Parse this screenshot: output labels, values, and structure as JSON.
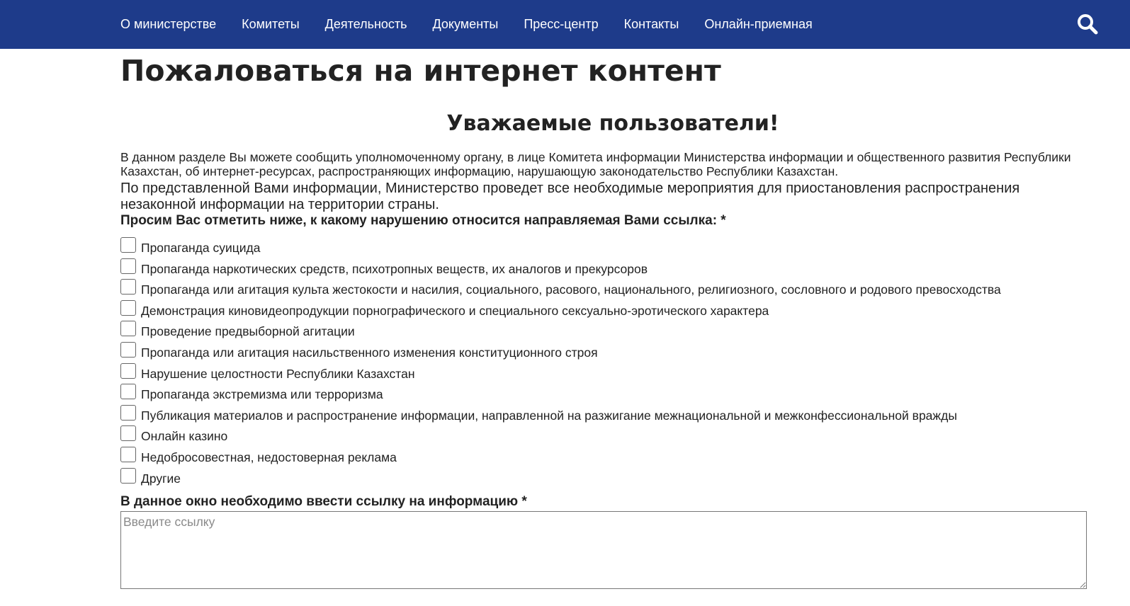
{
  "header": {
    "nav_items": [
      "О министерстве",
      "Комитеты",
      "Деятельность",
      "Документы",
      "Пресс-центр",
      "Контакты",
      "Онлайн-приемная"
    ],
    "search_icon": "search-icon",
    "background_color": "#1e3b8a"
  },
  "main": {
    "title": "Пожаловаться на интернет контент",
    "greeting": "Уважаемые пользователи!",
    "intro_text": "В данном разделе Вы можете сообщить уполномоченному органу, в лице Комитета информации Министерства информации и общественного развития Республики Казахстан, об интернет-ресурсах, распространяющих информацию, нарушающую законодательство Республики Казахстан.",
    "intro_text_2": "По представленной Вами информации, Министерство проведет все необходимые мероприятия для приостановления распространения незаконной информации на территории страны.",
    "violation_question": "Просим Вас отметить ниже, к какому нарушению относится направляемая Вами ссылка: *",
    "violation_options": [
      "Пропаганда суицида",
      "Пропаганда наркотических средств, психотропных веществ, их аналогов и прекурсоров",
      "Пропаганда или агитация культа жестокости и насилия, социального, расового, национального, религиозного, сословного и родового превосходства",
      "Демонстрация киновидеопродукции порнографического и специального сексуально-эротического характера",
      "Проведение предвыборной агитации",
      "Пропаганда или агитация насильственного изменения конституционного строя",
      "Нарушение целостности Республики Казахстан",
      "Пропаганда экстремизма или терроризма",
      "Публикация материалов и распространение информации, направленной на разжигание межнациональной и межконфессиональной вражды",
      "Онлайн казино",
      "Недобросовестная, недостоверная реклама",
      "Другие"
    ],
    "link_label": "В данное окно необходимо ввести ссылку на информацию *",
    "link_placeholder": "Введите ссылку",
    "link_value": ""
  }
}
